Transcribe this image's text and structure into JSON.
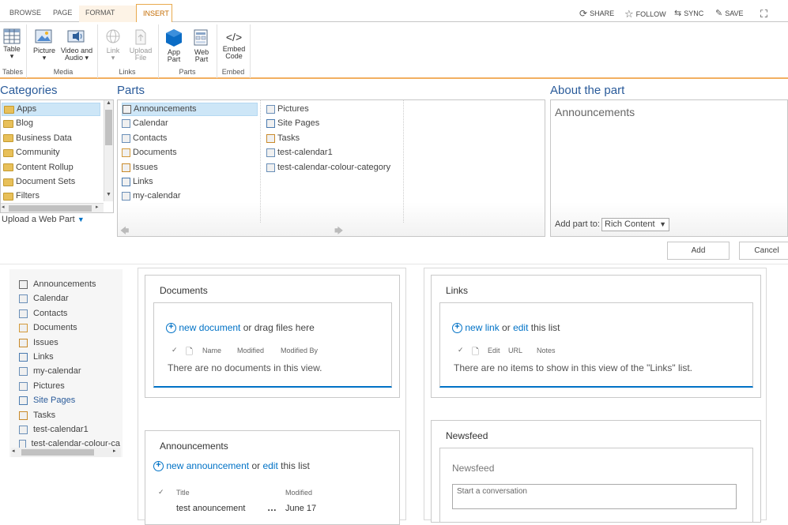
{
  "tabs": [
    "BROWSE",
    "PAGE",
    "FORMAT TEXT",
    "INSERT"
  ],
  "top_actions": [
    "SHARE",
    "FOLLOW",
    "SYNC",
    "SAVE"
  ],
  "ribbon": {
    "table": "Table",
    "picture": "Picture",
    "video_audio_1": "Video and",
    "video_audio_2": "Audio",
    "link": "Link",
    "upload_1": "Upload",
    "upload_2": "File",
    "app_part_1": "App",
    "app_part_2": "Part",
    "web_part_1": "Web",
    "web_part_2": "Part",
    "embed_1": "Embed",
    "embed_2": "Code",
    "groups": [
      "Tables",
      "Media",
      "Links",
      "Parts",
      "Embed"
    ]
  },
  "picker": {
    "categories_title": "Categories",
    "parts_title": "Parts",
    "about_title": "About the part",
    "categories": [
      "Apps",
      "Blog",
      "Business Data",
      "Community",
      "Content Rollup",
      "Document Sets",
      "Filters"
    ],
    "parts_col1": [
      "Announcements",
      "Calendar",
      "Contacts",
      "Documents",
      "Issues",
      "Links",
      "my-calendar"
    ],
    "parts_col2": [
      "Pictures",
      "Site Pages",
      "Tasks",
      "test-calendar1",
      "test-calendar-colour-category"
    ],
    "about_name": "Announcements",
    "upload_webpart": "Upload a Web Part",
    "add_part_to": "Add part to:",
    "add_part_select": "Rich Content",
    "add_button": "Add",
    "cancel_button": "Cancel"
  },
  "left_nav": [
    "Announcements",
    "Calendar",
    "Contacts",
    "Documents",
    "Issues",
    "Links",
    "my-calendar",
    "Pictures",
    "Site Pages",
    "Tasks",
    "test-calendar1",
    "test-calendar-colour-ca"
  ],
  "documents": {
    "title": "Documents",
    "new_link": "new document",
    "or_text": "or drag files here",
    "col_name": "Name",
    "col_modified": "Modified",
    "col_modified_by": "Modified By",
    "empty": "There are no documents in this view."
  },
  "links": {
    "title": "Links",
    "new_link": "new link",
    "or_text": "or",
    "edit_link": "edit",
    "this_list": "this list",
    "col_edit": "Edit",
    "col_url": "URL",
    "col_notes": "Notes",
    "empty": "There are no items to show in this view of the \"Links\" list."
  },
  "announcements": {
    "title": "Announcements",
    "new_link": "new announcement",
    "or_text": "or",
    "edit_link": "edit",
    "this_list": "this list",
    "col_title": "Title",
    "col_modified": "Modified",
    "row_title": "test anouncement",
    "row_dots": "…",
    "row_modified": "June 17"
  },
  "newsfeed": {
    "title": "Newsfeed",
    "subtitle": "Newsfeed",
    "placeholder": "Start a conversation"
  }
}
